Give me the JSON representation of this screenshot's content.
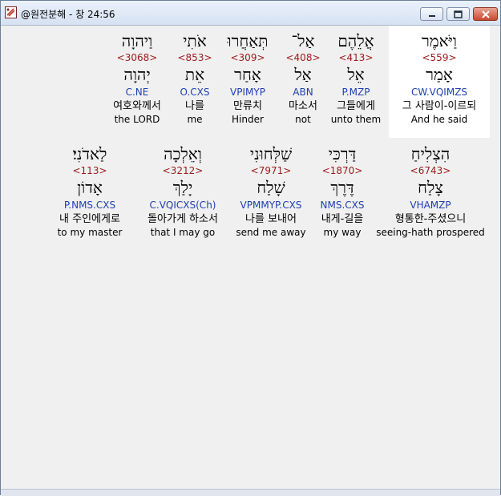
{
  "window": {
    "title": "@원전분해 - 창 24:56",
    "icons": {
      "app": "bible-app-icon",
      "minimize": "minimize-icon",
      "maximize": "maximize-icon",
      "close": "close-icon"
    }
  },
  "rows": [
    {
      "words": [
        {
          "hebrew": "וַיֹּאמֶר",
          "strong": "<559>",
          "lemma": "אָמַר",
          "morph": "CW.VQIMZS",
          "korean": "그 사람이-이르되",
          "english": "And he said"
        },
        {
          "hebrew": "אֲלֵהֶם",
          "strong": "<413>",
          "lemma": "אֵל",
          "morph": "P.MZP",
          "korean": "그들에게",
          "english": "unto them"
        },
        {
          "hebrew": "אַל־",
          "strong": "<408>",
          "lemma": "אַל",
          "morph": "ABN",
          "korean": "마소서",
          "english": "not"
        },
        {
          "hebrew": "תְּאַחֲרוּ",
          "strong": "<309>",
          "lemma": "אָחַר",
          "morph": "VPIMYP",
          "korean": "만류치",
          "english": "Hinder"
        },
        {
          "hebrew": "אֹתִי",
          "strong": "<853>",
          "lemma": "אֵת",
          "morph": "O.CXS",
          "korean": "나를",
          "english": "me"
        },
        {
          "hebrew": "וַיהוָה",
          "strong": "<3068>",
          "lemma": "יְהוָה",
          "morph": "C.NE",
          "korean": "여호와께서",
          "english": "the LORD"
        }
      ]
    },
    {
      "words": [
        {
          "hebrew": "הִצְלִיחַ",
          "strong": "<6743>",
          "lemma": "צָלַח",
          "morph": "VHAMZP",
          "korean": "형통한-주셨으니",
          "english": "seeing-hath prospered"
        },
        {
          "hebrew": "דַּרְכִּי",
          "strong": "<1870>",
          "lemma": "דֶּרֶךְ",
          "morph": "NMS.CXS",
          "korean": "내게-길을",
          "english": "my way"
        },
        {
          "hebrew": "שַׁלְּחוּנִי",
          "strong": "<7971>",
          "lemma": "שָׁלַח",
          "morph": "VPMMYP.CXS",
          "korean": "나를 보내어",
          "english": "send me away"
        },
        {
          "hebrew": "וְאֵלְכָה",
          "strong": "<3212>",
          "lemma": "יָלַךְ",
          "morph": "C.VQICXS(Ch)",
          "korean": "돌아가게 하소서",
          "english": "that I may go"
        },
        {
          "hebrew": "לַאדֹנִי׃",
          "strong": "<113>",
          "lemma": "אָדוֹן",
          "morph": "P.NMS.CXS",
          "korean": "내 주인에게로",
          "english": "to my master"
        }
      ]
    }
  ],
  "selected_word": "וַיֹּאמֶר"
}
